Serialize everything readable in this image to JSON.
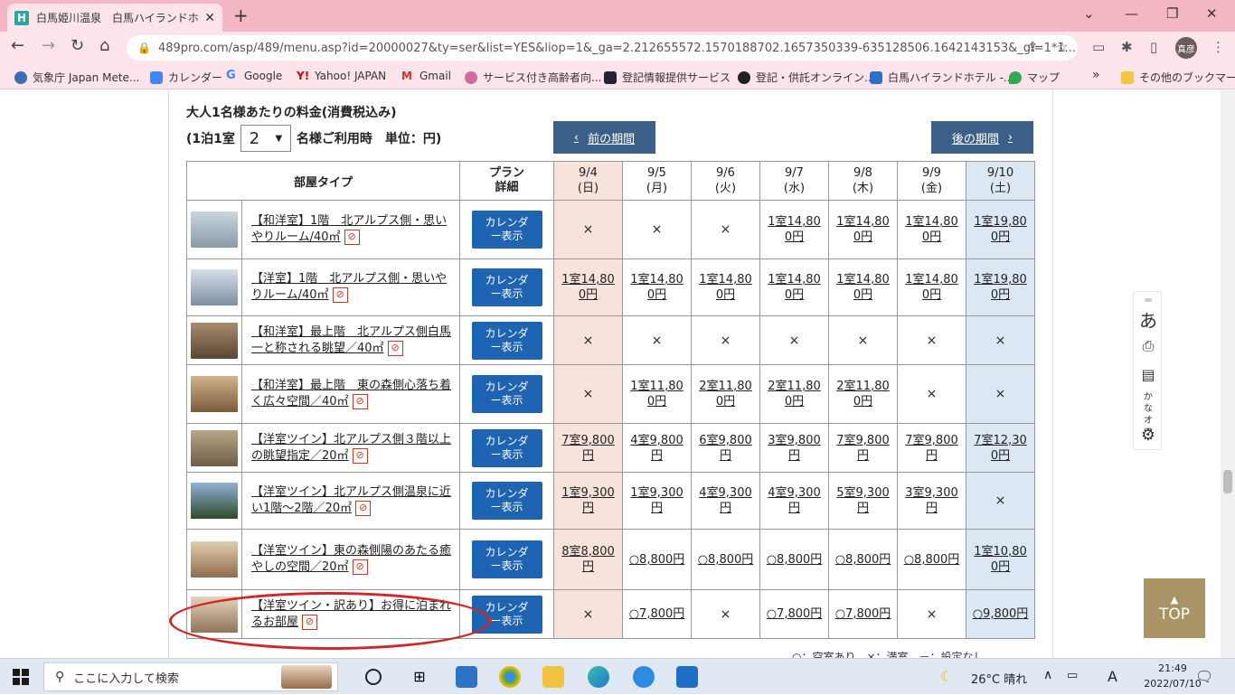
{
  "browser": {
    "tab_title": "白馬姫川温泉　白馬ハイランドホテル",
    "favicon_letter": "H",
    "url": "489pro.com/asp/489/menu.asp?id=20000027&ty=ser&list=YES&liop=1&_ga=2.212655572.1570188702.1657350339-635128506.1642143153&_gl=1*1...",
    "profile_label": "真彦",
    "bookmarks": [
      "気象庁 Japan Mete...",
      "カレンダー",
      "Google",
      "Yahoo! JAPAN",
      "Gmail",
      "サービス付き高齢者向...",
      "登記情報提供サービス",
      "登記・供託オンライン...",
      "白馬ハイランドホテル -...",
      "マップ"
    ],
    "bookmarks_more": "»",
    "other_bookmarks": "その他のブックマーク"
  },
  "page": {
    "heading": "大人1名様あたりの料金(消費税込み)",
    "sub_prefix": "(1泊1室",
    "room_count": "2",
    "sub_suffix": "名様ご利用時　単位：円)",
    "prev_period": "前の期間",
    "next_period": "後の期間",
    "prev_arrow": "‹",
    "next_arrow": "›",
    "col_room_type": "部屋タイプ",
    "col_plan": "プラン詳細",
    "calendar_button": "カレンダー表示",
    "dates": [
      {
        "date": "9/4",
        "day": "(日)"
      },
      {
        "date": "9/5",
        "day": "(月)"
      },
      {
        "date": "9/6",
        "day": "(火)"
      },
      {
        "date": "9/7",
        "day": "(水)"
      },
      {
        "date": "9/8",
        "day": "(木)"
      },
      {
        "date": "9/9",
        "day": "(金)"
      },
      {
        "date": "9/10",
        "day": "(土)"
      }
    ],
    "rooms": [
      {
        "name": "【和洋室】1階　北アルプス側・思いやりルーム/40㎡",
        "cells": [
          "×",
          "×",
          "×",
          "1室14,800円",
          "1室14,800円",
          "1室14,800円",
          "1室19,800円"
        ]
      },
      {
        "name": "【洋室】1階　北アルプス側・思いやりルーム/40㎡",
        "cells": [
          "1室14,800円",
          "1室14,800円",
          "1室14,800円",
          "1室14,800円",
          "1室14,800円",
          "1室14,800円",
          "1室19,800円"
        ]
      },
      {
        "name": "【和洋室】最上階　北アルプス側白馬一と称される眺望／40㎡",
        "cells": [
          "×",
          "×",
          "×",
          "×",
          "×",
          "×",
          "×"
        ]
      },
      {
        "name": "【和洋室】最上階　東の森側心落ち着く広々空間／40㎡",
        "cells": [
          "×",
          "1室11,800円",
          "2室11,800円",
          "2室11,800円",
          "2室11,800円",
          "×",
          "×"
        ]
      },
      {
        "name": "【洋室ツイン】北アルプス側３階以上の眺望指定／20㎡",
        "cells": [
          "7室9,800円",
          "4室9,800円",
          "6室9,800円",
          "3室9,800円",
          "7室9,800円",
          "7室9,800円",
          "7室12,300円"
        ]
      },
      {
        "name": "【洋室ツイン】北アルプス側温泉に近い1階～2階／20㎡",
        "cells": [
          "1室9,300円",
          "1室9,300円",
          "4室9,300円",
          "4室9,300円",
          "5室9,300円",
          "3室9,300円",
          "×"
        ]
      },
      {
        "name": "【洋室ツイン】東の森側陽のあたる癒やしの空間／20㎡",
        "cells": [
          "8室8,800円",
          "○8,800円",
          "○8,800円",
          "○8,800円",
          "○8,800円",
          "○8,800円",
          "1室10,800円"
        ]
      },
      {
        "name": "【洋室ツイン・訳あり】お得に泊まれるお部屋",
        "cells": [
          "×",
          "○7,800円",
          "×",
          "○7,800円",
          "○7,800円",
          "×",
          "○9,800円"
        ]
      }
    ],
    "legend": "○：空室あり　×：満室　－：設定なし"
  },
  "side_widget": {
    "kana": "あ",
    "kana_off": "かなオフ"
  },
  "top_button": {
    "arrow": "▲",
    "label": "TOP"
  },
  "taskbar": {
    "search_placeholder": "ここに入力して検索",
    "weather": "26°C  晴れ",
    "ime": "A",
    "time": "21:49",
    "date": "2022/07/10"
  },
  "colors": {
    "sunday": "#f8e3dc",
    "saturday": "#dbe8f3",
    "button": "#1f63b3",
    "period": "#3b5f86",
    "highlight": "#cc2a2a"
  }
}
